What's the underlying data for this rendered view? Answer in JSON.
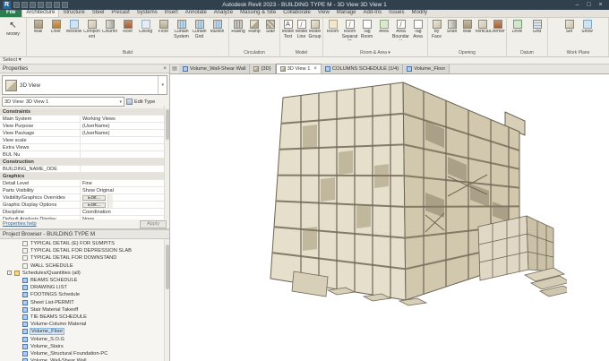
{
  "colors": {
    "file_tab_green": "#2a7d4f",
    "selection_blue": "#cfe4f7",
    "model_tan": "#d8cfba"
  },
  "titlebar": {
    "title": "Autodesk Revit 2023 - BUILDING TYPE M - 3D View 3D View 1",
    "logo": "R",
    "qat": [
      "open",
      "save",
      "undo",
      "redo",
      "print",
      "measure",
      "tag"
    ],
    "window_controls": [
      "–",
      "□",
      "×"
    ]
  },
  "ribbon": {
    "file_tab": "File",
    "tabs": [
      {
        "label": "Architecture",
        "cls": "active"
      },
      {
        "label": "Structure"
      },
      {
        "label": "Steel"
      },
      {
        "label": "Precast"
      },
      {
        "label": "Systems"
      },
      {
        "label": "Insert"
      },
      {
        "label": "Annotate"
      },
      {
        "label": "Analyze"
      },
      {
        "label": "Massing & Site"
      },
      {
        "label": "Collaborate"
      },
      {
        "label": "View"
      },
      {
        "label": "Manage"
      },
      {
        "label": "Add-Ins"
      },
      {
        "label": "Issues"
      },
      {
        "label": "Modify"
      }
    ],
    "groups": [
      {
        "label": "",
        "tools": [
          {
            "label": "Modify",
            "icon": "ic-cursor"
          }
        ]
      },
      {
        "label": "Build",
        "tools": [
          {
            "label": "Wall",
            "icon": "ic-wall"
          },
          {
            "label": "Door",
            "icon": "ic-door"
          },
          {
            "label": "Window",
            "icon": "ic-window"
          },
          {
            "label": "Component",
            "icon": "ic-comp"
          },
          {
            "label": "Column",
            "icon": "ic-column"
          },
          {
            "label": "Roof",
            "icon": "ic-roof"
          },
          {
            "label": "Ceiling",
            "icon": "ic-ceiling"
          },
          {
            "label": "Floor",
            "icon": "ic-floor"
          },
          {
            "label": "Curtain System",
            "icon": "ic-curtain"
          },
          {
            "label": "Curtain Grid",
            "icon": "ic-curtain"
          },
          {
            "label": "Mullion",
            "icon": "ic-curtain"
          }
        ]
      },
      {
        "label": "Circulation",
        "tools": [
          {
            "label": "Railing",
            "icon": "ic-rail"
          },
          {
            "label": "Ramp",
            "icon": "ic-ramp"
          },
          {
            "label": "Stair",
            "icon": "ic-stair"
          }
        ]
      },
      {
        "label": "Model",
        "tools": [
          {
            "label": "Model Text",
            "icon": "ic-text"
          },
          {
            "label": "Model Line",
            "icon": "ic-line"
          },
          {
            "label": "Model Group",
            "icon": "ic-comp"
          }
        ]
      },
      {
        "label": "Room & Area ▾",
        "tools": [
          {
            "label": "Room",
            "icon": "ic-room"
          },
          {
            "label": "Room Separator",
            "icon": "ic-line"
          },
          {
            "label": "Tag Room",
            "icon": "ic-tag"
          },
          {
            "label": "Area",
            "icon": "ic-area"
          },
          {
            "label": "Area Boundary",
            "icon": "ic-line"
          },
          {
            "label": "Tag Area",
            "icon": "ic-tag"
          }
        ]
      },
      {
        "label": "Opening",
        "tools": [
          {
            "label": "By Face",
            "icon": "ic-comp"
          },
          {
            "label": "Shaft",
            "icon": "ic-column"
          },
          {
            "label": "Wall",
            "icon": "ic-wall"
          },
          {
            "label": "Vertical",
            "icon": "ic-comp"
          },
          {
            "label": "Dormer",
            "icon": "ic-roof"
          }
        ]
      },
      {
        "label": "Datum",
        "tools": [
          {
            "label": "Level",
            "icon": "ic-level"
          },
          {
            "label": "Grid",
            "icon": "ic-grid"
          }
        ]
      },
      {
        "label": "Work Plane",
        "tools": [
          {
            "label": "Set",
            "icon": "ic-comp"
          },
          {
            "label": "Show",
            "icon": "ic-window"
          }
        ]
      }
    ],
    "select_bar": "Select ▾"
  },
  "properties": {
    "title": "Properties",
    "close": "×",
    "type_name": "3D View",
    "view_combo": "3D View: 3D View 1",
    "edit_type": "Edit Type",
    "rows": [
      {
        "type": "header",
        "label": "Constraints",
        "value": ""
      },
      {
        "type": "row",
        "label": "Main System",
        "value": "Working Views"
      },
      {
        "type": "row",
        "label": "View Purpose",
        "value": "(UserName)"
      },
      {
        "type": "row",
        "label": "View Package",
        "value": "(UserName)"
      },
      {
        "type": "row",
        "label": "View scale",
        "value": ""
      },
      {
        "type": "row",
        "label": "Extra Views",
        "value": ""
      },
      {
        "type": "row",
        "label": "BUL Nu",
        "value": ""
      },
      {
        "type": "header",
        "label": "Construction",
        "value": ""
      },
      {
        "type": "row",
        "label": "BUILDING_NAME_ODE",
        "value": ""
      },
      {
        "type": "header",
        "label": "Graphics",
        "value": ""
      },
      {
        "type": "row",
        "label": "Detail Level",
        "value": "Fine"
      },
      {
        "type": "row",
        "label": "Parts Visibility",
        "value": "Show Original"
      },
      {
        "type": "row",
        "label": "Visibility/Graphics Overrides",
        "value": "Edit...",
        "vcls": "btn"
      },
      {
        "type": "row",
        "label": "Graphic Display Options",
        "value": "Edit...",
        "vcls": "btn"
      },
      {
        "type": "row",
        "label": "Discipline",
        "value": "Coordination"
      },
      {
        "type": "row",
        "label": "Default Analysis Display",
        "value": "None"
      }
    ],
    "help": "Properties help",
    "apply": "Apply"
  },
  "browser": {
    "title": "Project Browser - BUILDING TYPE M",
    "items": [
      {
        "cls": "ind2",
        "icon": "sheet",
        "exp": "",
        "label": "TYPICAL DETAIL (E) FOR SUMPITS"
      },
      {
        "cls": "ind2",
        "icon": "sheet",
        "exp": "",
        "label": "TYPICAL DETAIL FOR DEPRESSION SLAB"
      },
      {
        "cls": "ind2",
        "icon": "sheet",
        "exp": "",
        "label": "TYPICAL DETAIL FOR DOWNSTAND"
      },
      {
        "cls": "ind2",
        "icon": "sheet",
        "exp": "",
        "label": "WALL SCHEDULE"
      },
      {
        "cls": "ind1",
        "icon": "folder",
        "exp": "-",
        "expcls": "box",
        "label": "Schedules/Quantities (all)"
      },
      {
        "cls": "ind2",
        "icon": "sched",
        "exp": "",
        "label": "BEAMS SCHEDULE"
      },
      {
        "cls": "ind2",
        "icon": "sched",
        "exp": "",
        "label": "DRAWING LIST"
      },
      {
        "cls": "ind2",
        "icon": "sched",
        "exp": "",
        "label": "FOOTINGS Schedule"
      },
      {
        "cls": "ind2",
        "icon": "sched",
        "exp": "",
        "label": "Sheet List-PERMIT"
      },
      {
        "cls": "ind2",
        "icon": "sched",
        "exp": "",
        "label": "Stair Material Takeoff"
      },
      {
        "cls": "ind2",
        "icon": "sched",
        "exp": "",
        "label": "TIE BEAMS SCHEDULE"
      },
      {
        "cls": "ind2",
        "icon": "sched",
        "exp": "",
        "label": "Volume-Column Material"
      },
      {
        "cls": "ind2 sel",
        "icon": "sched",
        "exp": "",
        "label": "Volume_Floor"
      },
      {
        "cls": "ind2",
        "icon": "sched",
        "exp": "",
        "label": "Volume_S.O.G"
      },
      {
        "cls": "ind2",
        "icon": "sched",
        "exp": "",
        "label": "Volume_Stairs"
      },
      {
        "cls": "ind2",
        "icon": "sched",
        "exp": "",
        "label": "Volume_Structural Foundation-PC"
      },
      {
        "cls": "ind2",
        "icon": "sched",
        "exp": "",
        "label": "Volume_Wall-Shear Wall"
      }
    ]
  },
  "viewtabs": {
    "close": "×",
    "tabs": [
      {
        "label": "Volume_Wall-Shear Wall",
        "icon": "sched"
      },
      {
        "label": "{3D}",
        "icon": "i3d"
      },
      {
        "label": "3D View 1",
        "icon": "i3d",
        "cls": "active"
      },
      {
        "label": "COLUMNS SCHEDULE (1/4)",
        "icon": "sched"
      },
      {
        "label": "Volume_Floor",
        "icon": "sched"
      }
    ]
  }
}
